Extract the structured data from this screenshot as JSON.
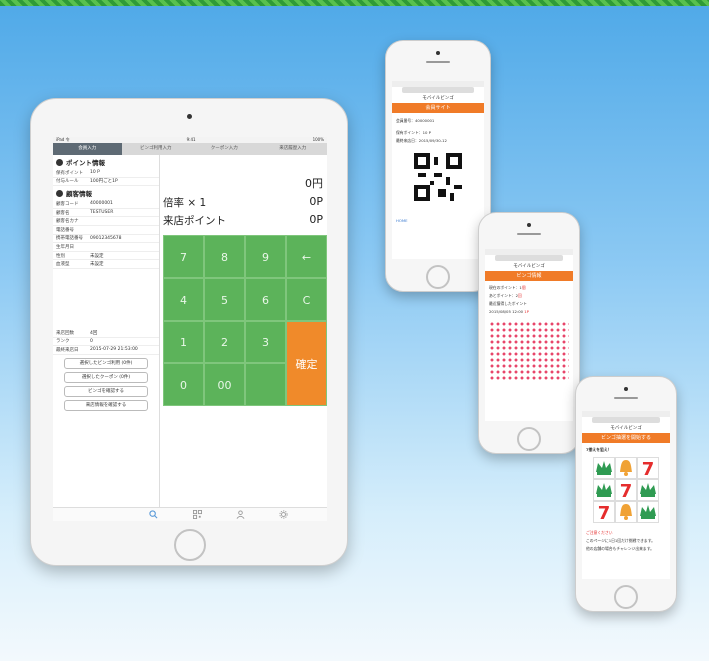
{
  "tablet": {
    "status": {
      "left": "iPad 令",
      "center": "9:41",
      "right": "100%"
    },
    "tabs": [
      "会員入力",
      "ビンゴ利用入力",
      "クーポン入力",
      "来店履歴入力"
    ],
    "point_section_title": "ポイント情報",
    "point_rows": [
      {
        "k": "保有ポイント",
        "v": "10 P"
      },
      {
        "k": "付与ルール",
        "v": "100円ごと1P"
      }
    ],
    "member_section_title": "顧客情報",
    "member_rows": [
      {
        "k": "顧客コード",
        "v": "40000001"
      },
      {
        "k": "顧客名",
        "v": "TESTUSER"
      },
      {
        "k": "顧客名カナ",
        "v": ""
      },
      {
        "k": "電話番号",
        "v": ""
      },
      {
        "k": "携帯電話番号",
        "v": "09012345678"
      },
      {
        "k": "生年月日",
        "v": ""
      },
      {
        "k": "性別",
        "v": "未設定"
      },
      {
        "k": "血液型",
        "v": "未設定"
      }
    ],
    "visit_rows": [
      {
        "k": "来店回数",
        "v": "4回"
      },
      {
        "k": "ランク",
        "v": "0"
      },
      {
        "k": "最終来店日",
        "v": "2015-07-29 21:53:00"
      }
    ],
    "buttons": [
      "選択したビンゴ利用 (0件)",
      "選択したクーポン (0件)",
      "ビンゴを確認する",
      "来店情報を確認する"
    ],
    "amounts": {
      "yen": "0円",
      "rate_label": "倍率 × 1",
      "rate_value": "0P",
      "visit_label": "来店ポイント",
      "visit_value": "0P"
    },
    "keys": [
      "7",
      "8",
      "9",
      "←",
      "4",
      "5",
      "6",
      "C",
      "1",
      "2",
      "3",
      "確定",
      "0",
      "00"
    ],
    "nav_icons": [
      "search-icon",
      "qr-icon",
      "person-icon",
      "gear-icon"
    ],
    "colors": {
      "keypad": "#5cb35a",
      "confirm": "#f08a2a",
      "tab_active": "#5e6a74"
    }
  },
  "phone1": {
    "app_title": "モバイルビンゴ",
    "header": "会員サイト",
    "lines": [
      "会員番号：40000001",
      "保有ポイント：10 P",
      "最終来店日：2015/09/30-12"
    ],
    "link": "HOME"
  },
  "phone2": {
    "app_title": "モバイルビンゴ",
    "header": "ビンゴ情報",
    "lines": [
      "現在のポイント：1",
      "あとポイント：2",
      "最近獲得したポイント",
      "2015/08/05 12:00"
    ],
    "red_suffixes": [
      "個",
      "回",
      "",
      "1P"
    ]
  },
  "phone3": {
    "app_title": "モバイルビンゴ",
    "header": "ビンゴ抽選を開始する",
    "intro": "7揃えを狙え！",
    "slots": [
      "crown",
      "bell",
      "7",
      "crown",
      "7",
      "crown",
      "7",
      "bell",
      "crown"
    ],
    "result": "ご注意ください",
    "footer_lines": [
      "このページに1日1回だけ挑戦できます。",
      "他の店舗の場合もチャレンジ出来ます。"
    ]
  }
}
